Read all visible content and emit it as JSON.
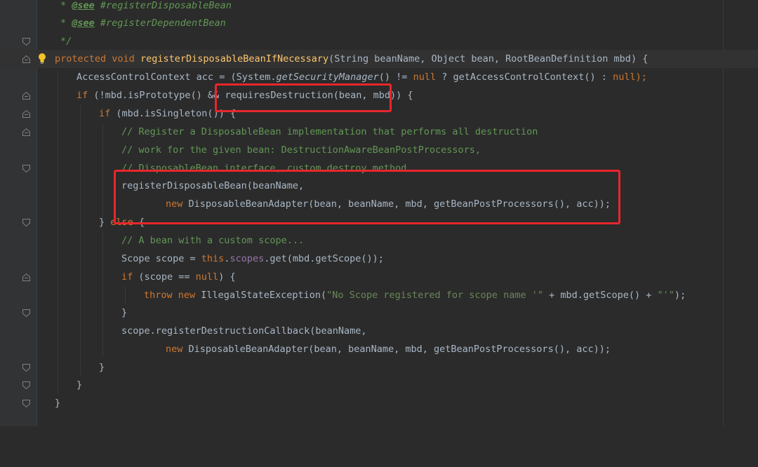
{
  "editor": {
    "theme_colors": {
      "background": "#2b2b2b",
      "keyword": "#cc7832",
      "method_decl": "#ffc66d",
      "comment": "#629755",
      "field": "#9876aa",
      "string": "#6a8759",
      "highlight_box": "#e8262c"
    },
    "lines": [
      {
        "doc_see": "@see",
        "rest": " #registerDisposableBean"
      },
      {
        "doc_see": "@see",
        "rest": " #registerDependentBean"
      },
      {
        "end": "*/"
      },
      {
        "kw_protected": "protected",
        "kw_void": "void",
        "method": "registerDisposableBeanIfNecessary",
        "params": "(String beanName, Object bean, RootBeanDefinition mbd) {"
      },
      {
        "a": "AccessControlContext acc = (System.",
        "b": "getSecurityManager",
        "c": "() != ",
        "null1": "null",
        "d": " ? getAccessControlContext() : ",
        "null2": "null",
        "e": ");"
      },
      {
        "kw_if": "if",
        "a": " (!mbd.isPrototype() && requiresDestruction(bean, mbd)) {"
      },
      {
        "kw_if": "if",
        "a": " (mbd.isSingleton()) {"
      },
      {
        "comment": "// Register a DisposableBean implementation that performs all destruction"
      },
      {
        "comment": "// work for the given bean: DestructionAwareBeanPostProcessors,"
      },
      {
        "comment": "// DisposableBean interface, custom destroy method."
      },
      {
        "a": "registerDisposableBean(beanName,"
      },
      {
        "kw_new": "new",
        "a": " DisposableBeanAdapter(bean, beanName, mbd, getBeanPostProcessors(), acc));"
      },
      {
        "a": "} ",
        "kw_else": "else",
        "b": " {"
      },
      {
        "comment": "// A bean with a custom scope..."
      },
      {
        "a": "Scope scope = ",
        "kw_this": "this",
        "b": ".",
        "field": "scopes",
        "c": ".get(mbd.getScope());"
      },
      {
        "kw_if": "if",
        "a": " (scope == ",
        "null1": "null",
        "b": ") {"
      },
      {
        "kw_throw": "throw",
        "kw_new": "new",
        "a": " IllegalStateException(",
        "str1": "\"No Scope registered for scope name '\"",
        "b": " + mbd.getScope() + ",
        "str2": "\"'\"",
        "c": ");"
      },
      {
        "a": "}"
      },
      {
        "a": "scope.registerDestructionCallback(beanName,"
      },
      {
        "kw_new": "new",
        "a": " DisposableBeanAdapter(bean, beanName, mbd, getBeanPostProcessors(), acc));"
      },
      {
        "a": "}"
      },
      {
        "a": "}"
      },
      {
        "a": "}"
      }
    ]
  }
}
